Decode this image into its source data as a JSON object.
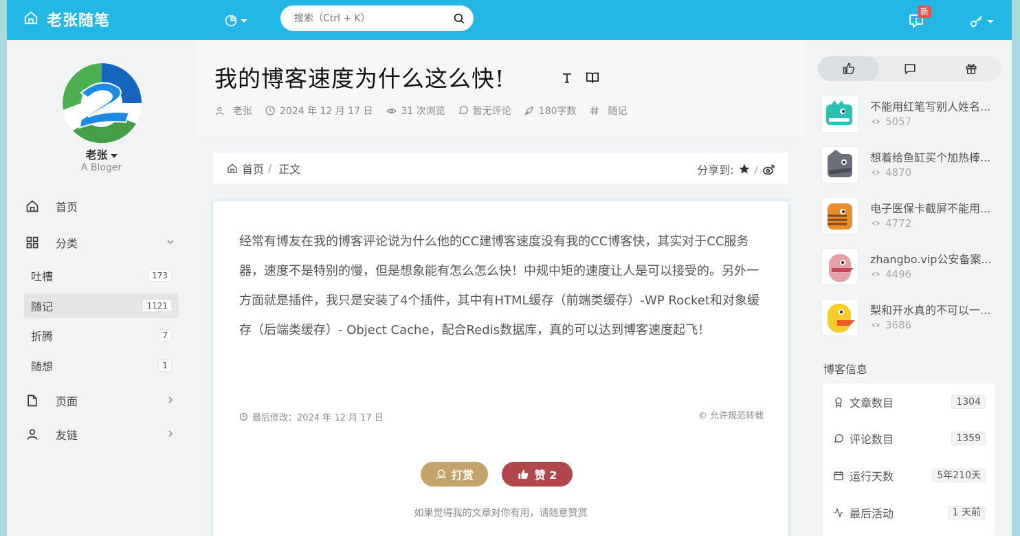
{
  "header": {
    "brand": "老张随笔",
    "search_placeholder": "搜索（Ctrl + K）",
    "new_badge": "新"
  },
  "profile": {
    "name": "老张",
    "tagline": "A Bloger"
  },
  "nav": {
    "home": "首页",
    "categories": "分类",
    "pages": "页面",
    "links": "友链",
    "sub_items": [
      {
        "label": "吐槽",
        "count": "173"
      },
      {
        "label": "随记",
        "count": "1121"
      },
      {
        "label": "折腾",
        "count": "7"
      },
      {
        "label": "随想",
        "count": "1"
      }
    ]
  },
  "post": {
    "title": "我的博客速度为什么这么快!",
    "author": "老张",
    "date": "2024 年 12 月 17 日",
    "views": "31 次浏览",
    "comments": "暂无评论",
    "words": "180字数",
    "category": "随记",
    "content": "经常有博友在我的博客评论说为什么他的CC建博客速度没有我的CC博客快，其实对于CC服务器，速度不是特别的慢，但是想象能有怎么怎么快！中规中矩的速度让人是可以接受的。另外一方面就是插件，我只是安装了4个插件，其中有HTML缓存（前端类缓存）-WP Rocket和对象缓存（后端类缓存）- Object Cache，配合Redis数据库，真的可以达到博客速度起飞！",
    "modified": "最后修改：2024 年 12 月 17 日",
    "license": "© 允许规范转载",
    "reward_label": "打赏",
    "like_label": "赞 2",
    "reward_hint": "如果觉得我的文章对你有用，请随意赞赏"
  },
  "breadcrumb": {
    "home": "首页",
    "sep": "/",
    "current": "正文",
    "share_label": "分享到:",
    "share_sep": "/"
  },
  "hot_posts": [
    {
      "title": "不能用红笔写别人姓名...",
      "views": "5057",
      "color": "#2bc0b4"
    },
    {
      "title": "想着给鱼缸买个加热棒...",
      "views": "4870",
      "color": "#6b6f7a"
    },
    {
      "title": "电子医保卡截屏不能用...",
      "views": "4772",
      "color": "#e98d2c"
    },
    {
      "title": "zhangbo.vip公安备案...",
      "views": "4496",
      "color": "#e7a2a8"
    },
    {
      "title": "梨和开水真的不可以一...",
      "views": "3686",
      "color": "#f6cc2a"
    }
  ],
  "blog_info": {
    "section_title": "博客信息",
    "rows": [
      {
        "label": "文章数目",
        "value": "1304"
      },
      {
        "label": "评论数目",
        "value": "1359"
      },
      {
        "label": "运行天数",
        "value": "5年210天"
      },
      {
        "label": "最后活动",
        "value": "1 天前"
      }
    ]
  }
}
